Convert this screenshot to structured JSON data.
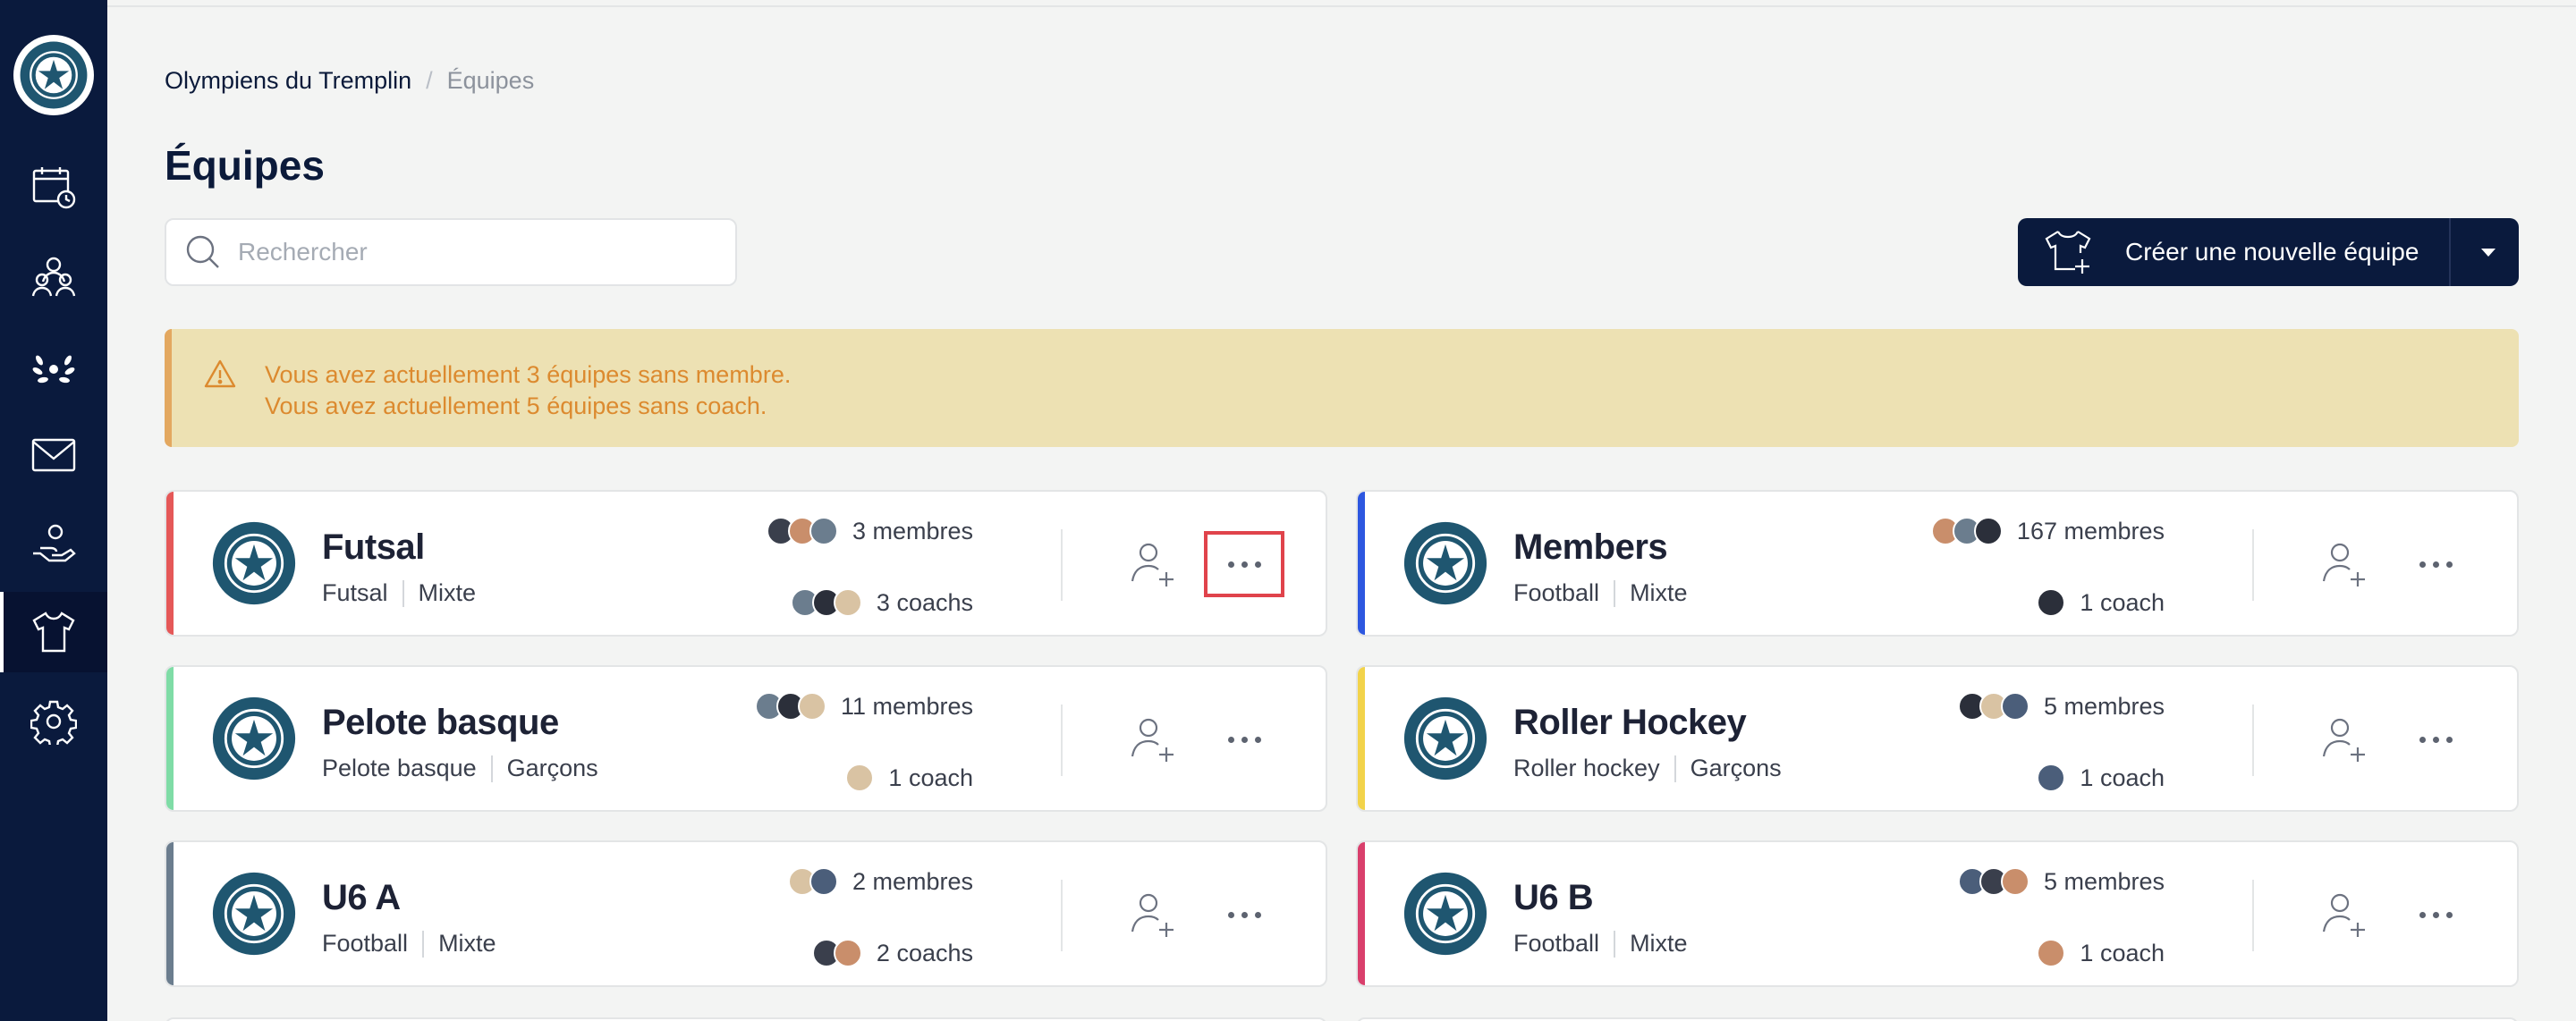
{
  "breadcrumb": {
    "root": "Olympiens du Tremplin",
    "separator": "/",
    "current": "Équipes"
  },
  "page_title": "Équipes",
  "search": {
    "placeholder": "Rechercher",
    "value": ""
  },
  "create_button": {
    "label": "Créer une nouvelle équipe"
  },
  "alert": {
    "line1": "Vous avez actuellement 3 équipes sans membre.",
    "line2": "Vous avez actuellement 5 équipes sans coach."
  },
  "colors": {
    "sidebar": "#0a1a3d",
    "alert_bg": "#ede1b3",
    "alert_text": "#dc8a2f",
    "highlight": "#e0434b"
  },
  "sidebar": {
    "items": [
      "calendar-icon",
      "users-icon",
      "laurel-icon",
      "mail-icon",
      "hand-heart-icon",
      "shirt-icon",
      "gear-icon"
    ],
    "active": "shirt-icon"
  },
  "teams": [
    {
      "name": "Futsal",
      "sport": "Futsal",
      "gender": "Mixte",
      "members": "3 membres",
      "coaches": "3 coachs",
      "accent": "#e55858",
      "member_avatars": 3,
      "coach_avatars": 3
    },
    {
      "name": "Members",
      "sport": "Football",
      "gender": "Mixte",
      "members": "167 membres",
      "coaches": "1 coach",
      "accent": "#2d57e0",
      "member_avatars": 3,
      "coach_avatars": 1
    },
    {
      "name": "Pelote basque",
      "sport": "Pelote basque",
      "gender": "Garçons",
      "members": "11 membres",
      "coaches": "1 coach",
      "accent": "#7fdca6",
      "member_avatars": 3,
      "coach_avatars": 1
    },
    {
      "name": "Roller Hockey",
      "sport": "Roller hockey",
      "gender": "Garçons",
      "members": "5 membres",
      "coaches": "1 coach",
      "accent": "#f2d34a",
      "member_avatars": 3,
      "coach_avatars": 1
    },
    {
      "name": "U6 A",
      "sport": "Football",
      "gender": "Mixte",
      "members": "2 membres",
      "coaches": "2 coachs",
      "accent": "#6b7d8e",
      "member_avatars": 2,
      "coach_avatars": 2
    },
    {
      "name": "U6 B",
      "sport": "Football",
      "gender": "Mixte",
      "members": "5 membres",
      "coaches": "1 coach",
      "accent": "#d93f6c",
      "member_avatars": 3,
      "coach_avatars": 1
    }
  ]
}
